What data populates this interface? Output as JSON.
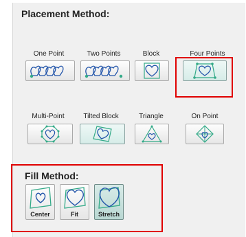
{
  "placement": {
    "title": "Placement Method:",
    "row1": [
      {
        "label": "One Point"
      },
      {
        "label": "Two Points"
      },
      {
        "label": "Block"
      },
      {
        "label": "Four Points"
      }
    ],
    "row2": [
      {
        "label": "Multi-Point"
      },
      {
        "label": "Tilted Block"
      },
      {
        "label": "Triangle"
      },
      {
        "label": "On Point"
      }
    ]
  },
  "fill": {
    "title": "Fill Method:",
    "buttons": [
      {
        "label": "Center"
      },
      {
        "label": "Fit"
      },
      {
        "label": "Stretch"
      }
    ]
  },
  "colors": {
    "highlight": "#e00000",
    "shape_green": "#33aa88",
    "heart_blue": "#2255aa"
  }
}
